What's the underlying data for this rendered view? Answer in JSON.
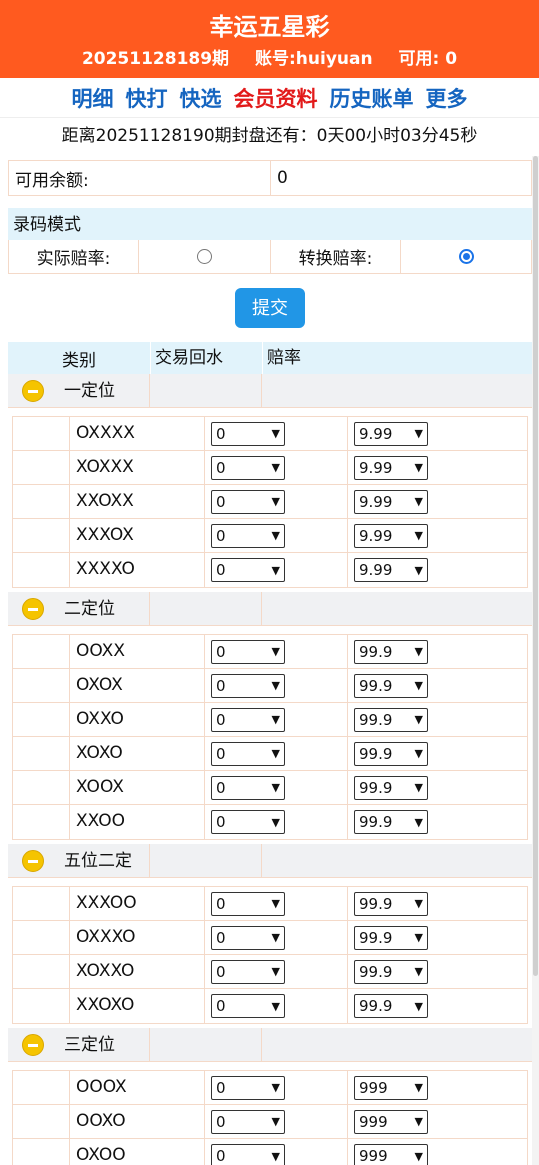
{
  "header": {
    "title": "幸运五星彩",
    "period": "20251128189期",
    "account": "账号:huiyuan",
    "available": "可用: 0"
  },
  "nav": [
    {
      "label": "明细",
      "active": false
    },
    {
      "label": "快打",
      "active": false
    },
    {
      "label": "快选",
      "active": false
    },
    {
      "label": "会员资料",
      "active": true
    },
    {
      "label": "历史账单",
      "active": false
    },
    {
      "label": "更多",
      "active": false
    }
  ],
  "countdown": "距离20251128190期封盘还有：0天00小时03分45秒",
  "balance": {
    "label": "可用余额:",
    "value": "0"
  },
  "mode": {
    "title": "录码模式",
    "actual_label": "实际赔率:",
    "convert_label": "转换赔率:",
    "selected": "convert"
  },
  "submit_label": "提交",
  "table_headers": {
    "category": "类别",
    "rebate": "交易回水",
    "odds": "赔率"
  },
  "sections": [
    {
      "name": "一定位",
      "rows": [
        {
          "label": "OXXXX",
          "rebate": "0",
          "odds": "9.99"
        },
        {
          "label": "XOXXX",
          "rebate": "0",
          "odds": "9.99"
        },
        {
          "label": "XXOXX",
          "rebate": "0",
          "odds": "9.99"
        },
        {
          "label": "XXXOX",
          "rebate": "0",
          "odds": "9.99"
        },
        {
          "label": "XXXXO",
          "rebate": "0",
          "odds": "9.99"
        }
      ]
    },
    {
      "name": "二定位",
      "rows": [
        {
          "label": "OOXX",
          "rebate": "0",
          "odds": "99.9"
        },
        {
          "label": "OXOX",
          "rebate": "0",
          "odds": "99.9"
        },
        {
          "label": "OXXO",
          "rebate": "0",
          "odds": "99.9"
        },
        {
          "label": "XOXO",
          "rebate": "0",
          "odds": "99.9"
        },
        {
          "label": "XOOX",
          "rebate": "0",
          "odds": "99.9"
        },
        {
          "label": "XXOO",
          "rebate": "0",
          "odds": "99.9"
        }
      ]
    },
    {
      "name": "五位二定",
      "rows": [
        {
          "label": "XXXOO",
          "rebate": "0",
          "odds": "99.9"
        },
        {
          "label": "OXXXO",
          "rebate": "0",
          "odds": "99.9"
        },
        {
          "label": "XOXXO",
          "rebate": "0",
          "odds": "99.9"
        },
        {
          "label": "XXOXO",
          "rebate": "0",
          "odds": "99.9"
        }
      ]
    },
    {
      "name": "三定位",
      "rows": [
        {
          "label": "OOOX",
          "rebate": "0",
          "odds": "999"
        },
        {
          "label": "OOXO",
          "rebate": "0",
          "odds": "999"
        },
        {
          "label": "OXOO",
          "rebate": "0",
          "odds": "999"
        }
      ]
    }
  ],
  "colors": {
    "header_bg": "#ff5a1f",
    "nav_link": "#1565c0",
    "nav_active": "#e21a1a",
    "button": "#2196e6"
  }
}
